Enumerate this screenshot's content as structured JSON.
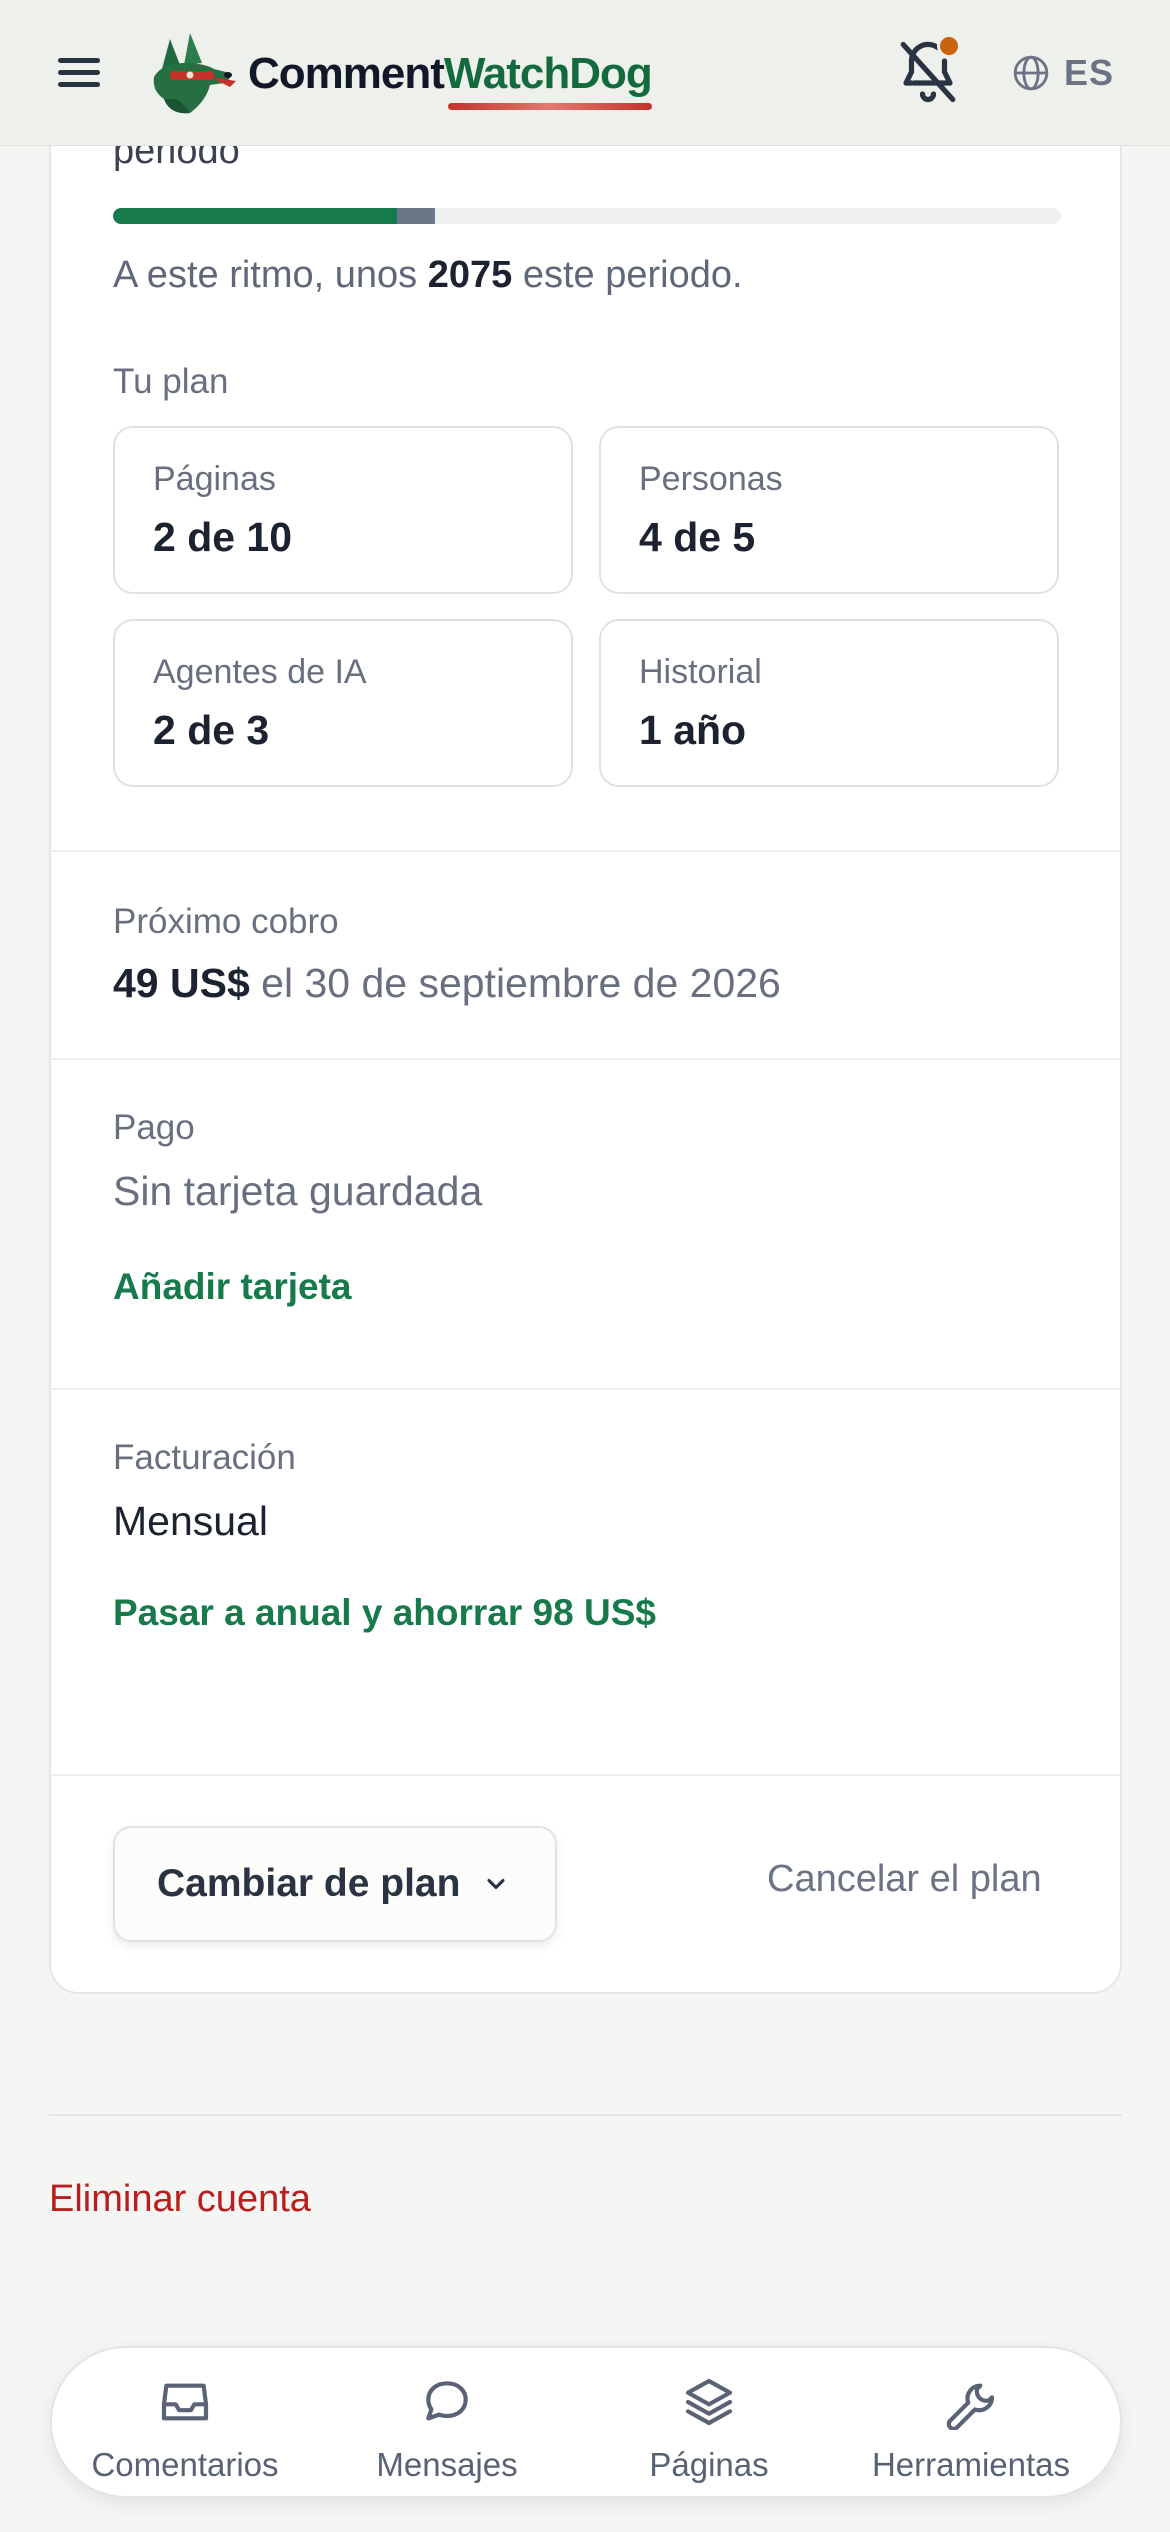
{
  "header": {
    "brand_part1": "Comment",
    "brand_part2": "WatchDog",
    "language": "ES"
  },
  "usage": {
    "partial_title": "periodo",
    "progress_fraction": 0.3,
    "projected_fraction": 0.04,
    "pace_prefix": "A este ritmo, unos ",
    "pace_number": "2075",
    "pace_suffix": " este periodo."
  },
  "plan": {
    "label": "Tu plan",
    "tiles": [
      {
        "label": "Páginas",
        "value": "2 de 10"
      },
      {
        "label": "Personas",
        "value": "4 de 5"
      },
      {
        "label": "Agentes de IA",
        "value": "2 de 3"
      },
      {
        "label": "Historial",
        "value": "1 año"
      }
    ]
  },
  "next_charge": {
    "label": "Próximo cobro",
    "amount": "49 US$",
    "date_text": " el 30 de septiembre de 2026"
  },
  "payment": {
    "label": "Pago",
    "value": "Sin tarjeta guardada",
    "add_card": "Añadir tarjeta"
  },
  "billing": {
    "label": "Facturación",
    "value": "Mensual",
    "upgrade": "Pasar a anual y ahorrar 98 US$"
  },
  "actions": {
    "change_plan": "Cambiar de plan",
    "cancel_plan": "Cancelar el plan"
  },
  "account": {
    "delete": "Eliminar cuenta"
  },
  "bottom_nav": [
    {
      "label": "Comentarios",
      "icon": "inbox-icon"
    },
    {
      "label": "Mensajes",
      "icon": "chat-bubble-icon"
    },
    {
      "label": "Páginas",
      "icon": "layers-icon"
    },
    {
      "label": "Herramientas",
      "icon": "wrench-icon"
    }
  ],
  "colors": {
    "accent_green": "#177a4a",
    "danger_red": "#b81e1e",
    "notification_dot": "#c8620d"
  }
}
